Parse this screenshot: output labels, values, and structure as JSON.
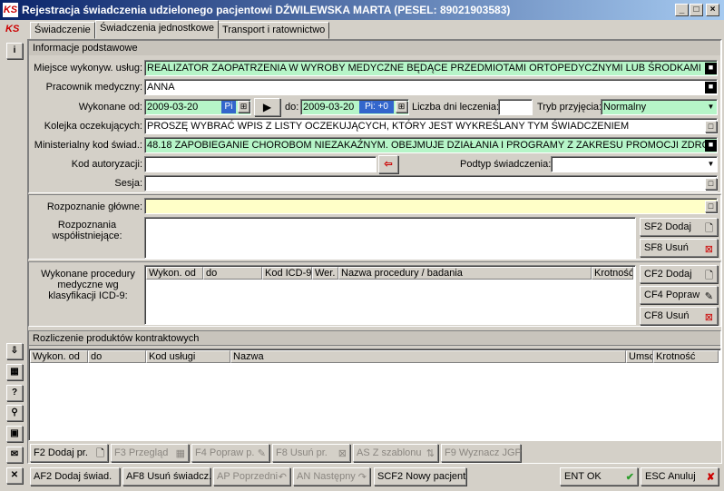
{
  "window": {
    "title": "Rejestracja świadczenia udzielonego pacjentowi DŹWILEWSKA MARTA (PESEL: 89021903583)",
    "logo": "KS",
    "minimize": "_",
    "maximize": "□",
    "close": "×"
  },
  "tabs": [
    {
      "label": "Świadczenie"
    },
    {
      "label": "Świadczenia jednostkowe"
    },
    {
      "label": "Transport i ratownictwo"
    }
  ],
  "basic": {
    "header": "Informacje podstawowe",
    "place_label": "Miejsce wykonyw. usług:",
    "place_value": "REALIZATOR ZAOPATRZENIA W WYROBY MEDYCZNE BĘDĄCE PRZEDMIOTAMI ORTOPEDYCZNYMI LUB ŚRODKAMI",
    "worker_label": "Pracownik medyczny:",
    "worker_value": "ANNA",
    "done_from_label": "Wykonane od:",
    "done_from_value": "2009-03-20",
    "done_from_day": "Pi",
    "to_label": "do:",
    "to_value": "2009-03-20",
    "to_day": "Pi: +0",
    "days_label": "Liczba dni leczenia:",
    "days_value": "",
    "mode_label": "Tryb przyjęcia:",
    "mode_value": "Normalny",
    "queue_label": "Kolejka oczekujących:",
    "queue_value": "PROSZĘ WYBRAĆ WPIS Z LISTY OCZEKUJĄCYCH, KTÓRY JEST WYKREŚLANY TYM ŚWIADCZENIEM",
    "ministry_label": "Ministerialny kod świad.:",
    "ministry_value": "48.18 ZAPOBIEGANIE CHOROBOM NIEZAKAŹNYM. OBEJMUJE DZIAŁANIA I PROGRAMY Z ZAKRESU PROMOCJI ZDRO",
    "auth_label": "Kod autoryzacji:",
    "auth_value": "",
    "subtype_label": "Podtyp świadczenia:",
    "subtype_value": "",
    "session_label": "Sesja:",
    "session_value": ""
  },
  "diagnosis": {
    "main_label": "Rozpoznanie główne:",
    "main_value": "",
    "co_label": "Rozpoznania współistniejące:",
    "add": "SF2 Dodaj",
    "remove": "SF8 Usuń"
  },
  "procedures": {
    "label": "Wykonane procedury medyczne wg klasyfikacji ICD-9:",
    "columns": [
      "Wykon. od",
      "do",
      "Kod ICD-9",
      "Wer.",
      "Nazwa procedury / badania",
      "Krotność"
    ],
    "add": "CF2 Dodaj",
    "edit": "CF4 Popraw",
    "remove": "CF8 Usuń"
  },
  "settlement": {
    "header": "Rozliczenie produktów kontraktowych",
    "columns": [
      "Wykon. od",
      "do",
      "Kod usługi",
      "Nazwa",
      "Umsc",
      "Krotność"
    ]
  },
  "toolbar1": [
    {
      "label": "F2 Dodaj pr.",
      "icon": "page-icon",
      "enabled": true
    },
    {
      "label": "F3 Przegląd",
      "icon": "grid-icon",
      "enabled": false
    },
    {
      "label": "F4 Popraw p.",
      "icon": "edit-icon",
      "enabled": false
    },
    {
      "label": "F8 Usuń pr.",
      "icon": "delete-icon",
      "enabled": false
    },
    {
      "label": "AS Z szablonu",
      "icon": "template-icon",
      "enabled": false
    },
    {
      "label": "F9 Wyznacz JGP",
      "icon": "",
      "enabled": false
    }
  ],
  "toolbar2": [
    {
      "label": "AF2 Dodaj świad.",
      "enabled": true
    },
    {
      "label": "AF8 Usuń świadcz.",
      "enabled": true
    },
    {
      "label": "AP Poprzedni",
      "enabled": false
    },
    {
      "label": "AN Następny",
      "enabled": false
    },
    {
      "label": "SCF2 Nowy pacjent",
      "enabled": true
    }
  ],
  "ok": "ENT OK",
  "cancel": "ESC Anuluj",
  "colors": {
    "green_field": "#b6f5c8",
    "yellow_field": "#ffffc8",
    "title_bar": "#0a246a",
    "day_badge": "#3366cc"
  }
}
